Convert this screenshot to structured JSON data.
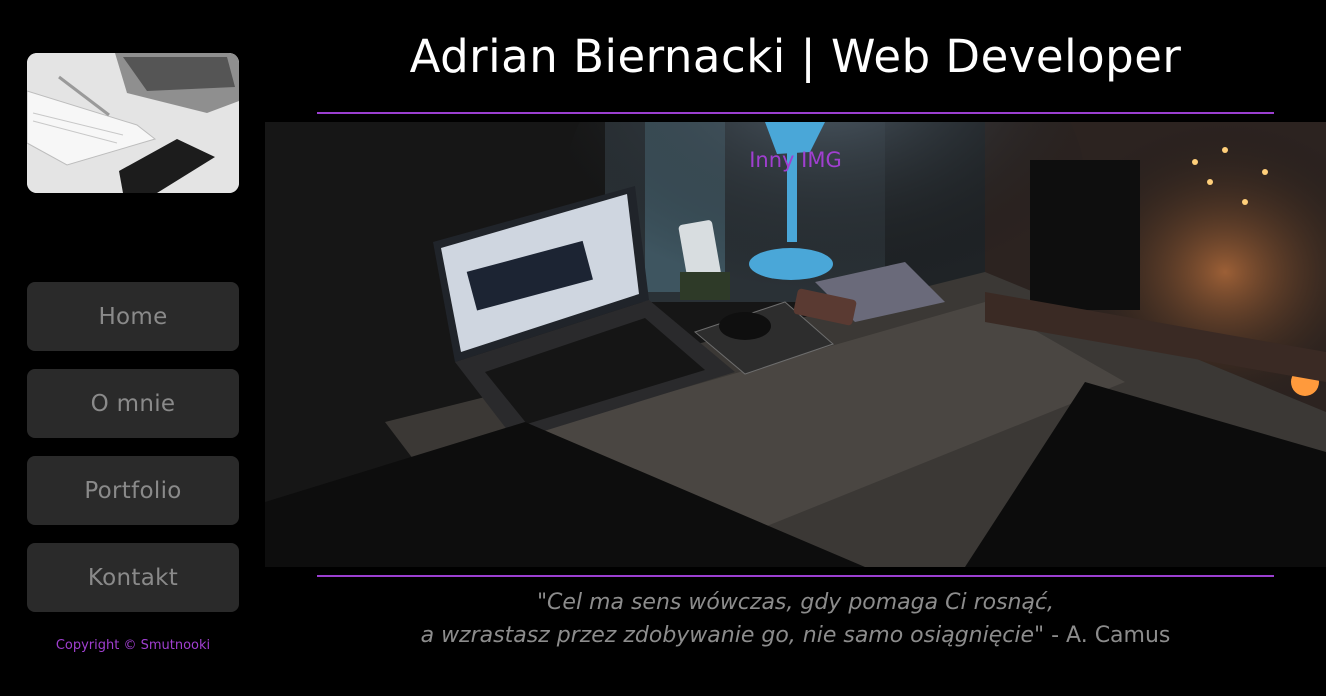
{
  "header": {
    "title": "Adrian Biernacki | Web Developer"
  },
  "sidebar": {
    "nav": [
      {
        "label": "Home"
      },
      {
        "label": "O mnie"
      },
      {
        "label": "Portfolio"
      },
      {
        "label": "Kontakt"
      }
    ],
    "copyright": "Copyright © Smutnooki"
  },
  "hero": {
    "caption": "Inny IMG"
  },
  "quote": {
    "line1": "\"Cel ma sens wówczas, gdy pomaga Ci rosnąć,",
    "line2": "a wzrastasz przez zdobywanie go, nie samo osiągnięcie\"",
    "author": " - A. Camus"
  },
  "colors": {
    "background": "#000000",
    "accent": "#9b3fd0",
    "nav_bg": "#2a2a2a",
    "nav_text": "#8a8a8a",
    "title_text": "#ffffff"
  }
}
